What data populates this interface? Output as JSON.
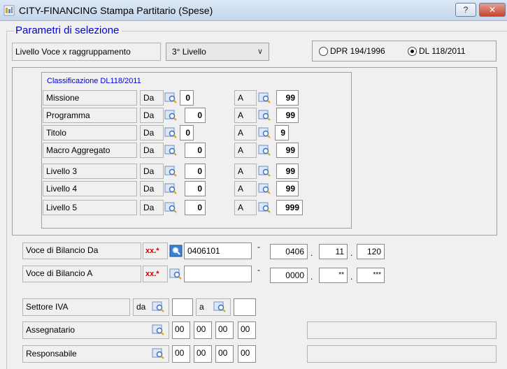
{
  "window": {
    "title": "CITY-FINANCING  Stampa Partitario  (Spese)",
    "help_label": "?",
    "close_label": "✕"
  },
  "group_title": "Parametri di selezione",
  "livello": {
    "label": "Livello Voce x raggruppamento",
    "value": "3° Livello"
  },
  "radios": [
    {
      "label": "DPR 194/1996",
      "selected": false
    },
    {
      "label": "DL 118/2011",
      "selected": true
    }
  ],
  "classificazione": {
    "title": "Classificazione DL118/2011",
    "da_label": "Da",
    "a_label": "A",
    "rows": [
      {
        "label": "Missione",
        "da": "0",
        "a": "99"
      },
      {
        "label": "Programma",
        "da": "0",
        "a": "99"
      },
      {
        "label": "Titolo",
        "da": "0",
        "a": "9"
      },
      {
        "label": "Macro Aggregato",
        "da": "0",
        "a": "99"
      },
      {
        "label": "Livello 3",
        "da": "0",
        "a": "99"
      },
      {
        "label": "Livello 4",
        "da": "0",
        "a": "99"
      },
      {
        "label": "Livello 5",
        "da": "0",
        "a": "999"
      }
    ]
  },
  "voce_da": {
    "label": "Voce di Bilancio Da",
    "prefix": "xx.",
    "required": "*",
    "code": "0406101",
    "dash": "-",
    "p1": "0406",
    "p2": "11",
    "p3": "120",
    "dot": "."
  },
  "voce_a": {
    "label": "Voce di Bilancio A",
    "prefix": "xx.",
    "required": "*",
    "code": "",
    "dash": "-",
    "p1": "0000",
    "p2": "**",
    "p3": "***",
    "dot": "."
  },
  "settore_iva": {
    "label": "Settore IVA",
    "da_label": "da",
    "a_label": "a",
    "da": "",
    "a": ""
  },
  "assegnatario": {
    "label": "Assegnatario",
    "values": [
      "00",
      "00",
      "00",
      "00"
    ]
  },
  "responsabile": {
    "label": "Responsabile",
    "values": [
      "00",
      "00",
      "00",
      "00"
    ]
  },
  "colors": {
    "title_blue": "#0000dd",
    "required_red": "#cc0000"
  }
}
